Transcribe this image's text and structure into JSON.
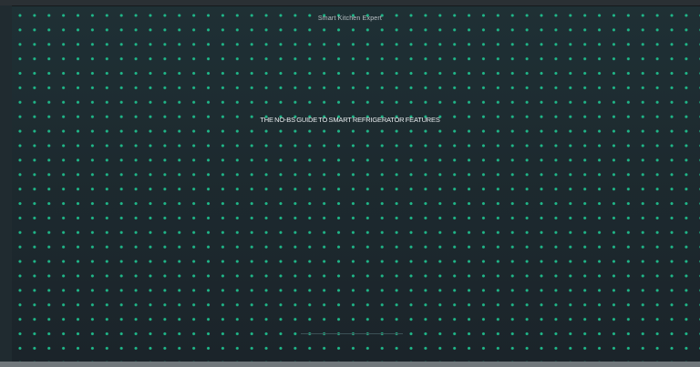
{
  "header": {
    "site_name": "Smart Kitchen Expert"
  },
  "hero": {
    "headline": "THE NO-BS GUIDE TO SMART REFRIGERATOR FEATURES"
  },
  "colors": {
    "background": "#1d2a2f",
    "dot_accent": "#1fb889",
    "text_primary": "#e8ecee",
    "text_secondary": "#b9c1c4"
  }
}
